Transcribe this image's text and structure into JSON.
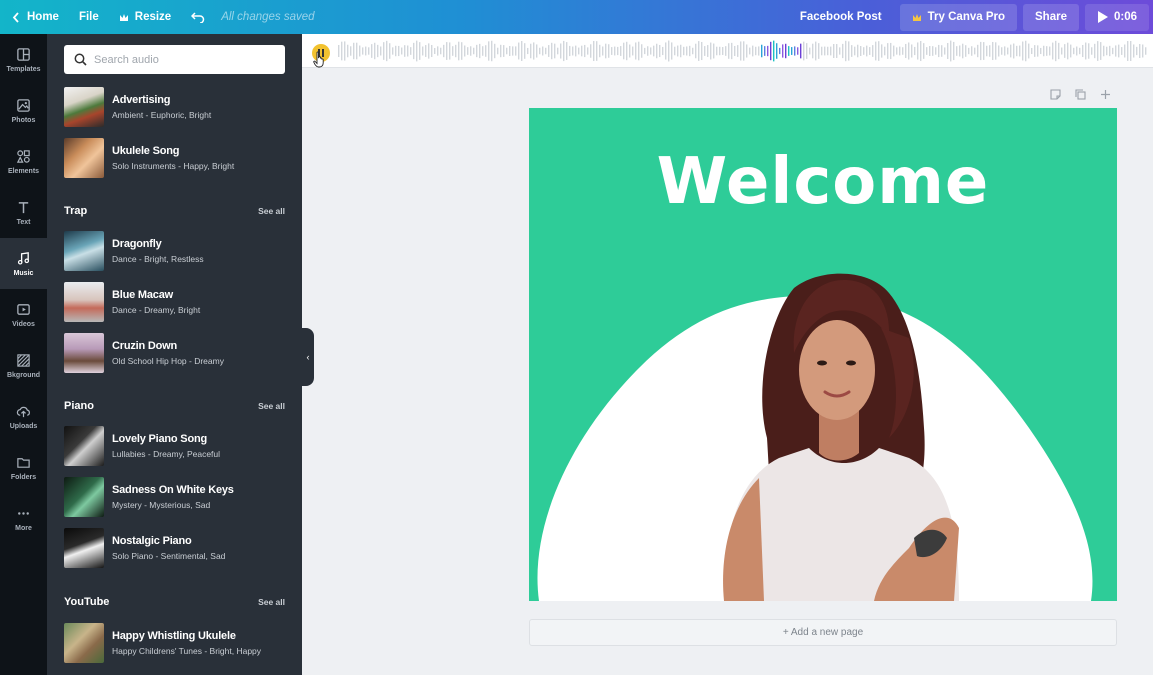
{
  "topbar": {
    "home_label": "Home",
    "file_label": "File",
    "resize_label": "Resize",
    "saved_status": "All changes saved",
    "design_type": "Facebook Post",
    "try_pro_label": "Try Canva Pro",
    "share_label": "Share",
    "play_time": "0:06"
  },
  "rail": {
    "templates": "Templates",
    "photos": "Photos",
    "elements": "Elements",
    "text": "Text",
    "music": "Music",
    "videos": "Videos",
    "bkground": "Bkground",
    "uploads": "Uploads",
    "folders": "Folders",
    "more": "More"
  },
  "search": {
    "placeholder": "Search audio"
  },
  "sections": {
    "trap": {
      "title": "Trap",
      "see_all": "See all"
    },
    "piano": {
      "title": "Piano",
      "see_all": "See all"
    },
    "youtube": {
      "title": "YouTube",
      "see_all": "See all"
    }
  },
  "tracks": [
    {
      "title": "Advertising",
      "sub": "Ambient - Euphoric, Bright"
    },
    {
      "title": "Ukulele Song",
      "sub": "Solo Instruments - Happy, Bright"
    },
    {
      "title": "Dragonfly",
      "sub": "Dance - Bright, Restless"
    },
    {
      "title": "Blue Macaw",
      "sub": "Dance - Dreamy, Bright"
    },
    {
      "title": "Cruzin Down",
      "sub": "Old School Hip Hop - Dreamy"
    },
    {
      "title": "Lovely Piano Song",
      "sub": "Lullabies - Dreamy, Peaceful"
    },
    {
      "title": "Sadness On White Keys",
      "sub": "Mystery - Mysterious, Sad"
    },
    {
      "title": "Nostalgic Piano",
      "sub": "Solo Piano - Sentimental, Sad"
    },
    {
      "title": "Happy Whistling Ukulele",
      "sub": "Happy Childrens' Tunes - Bright, Happy"
    }
  ],
  "canvas": {
    "headline": "Welcome",
    "add_page": "+ Add a new page",
    "bg_color": "#2ecc98"
  },
  "icons": {
    "back": "chevron-left-icon",
    "resize": "crown-icon",
    "undo": "undo-icon",
    "search": "search-icon",
    "play": "play-icon",
    "pause": "pause-icon",
    "collapse": "chevron-left-icon",
    "note": "note-icon",
    "duplicate": "duplicate-icon",
    "add": "plus-icon"
  }
}
